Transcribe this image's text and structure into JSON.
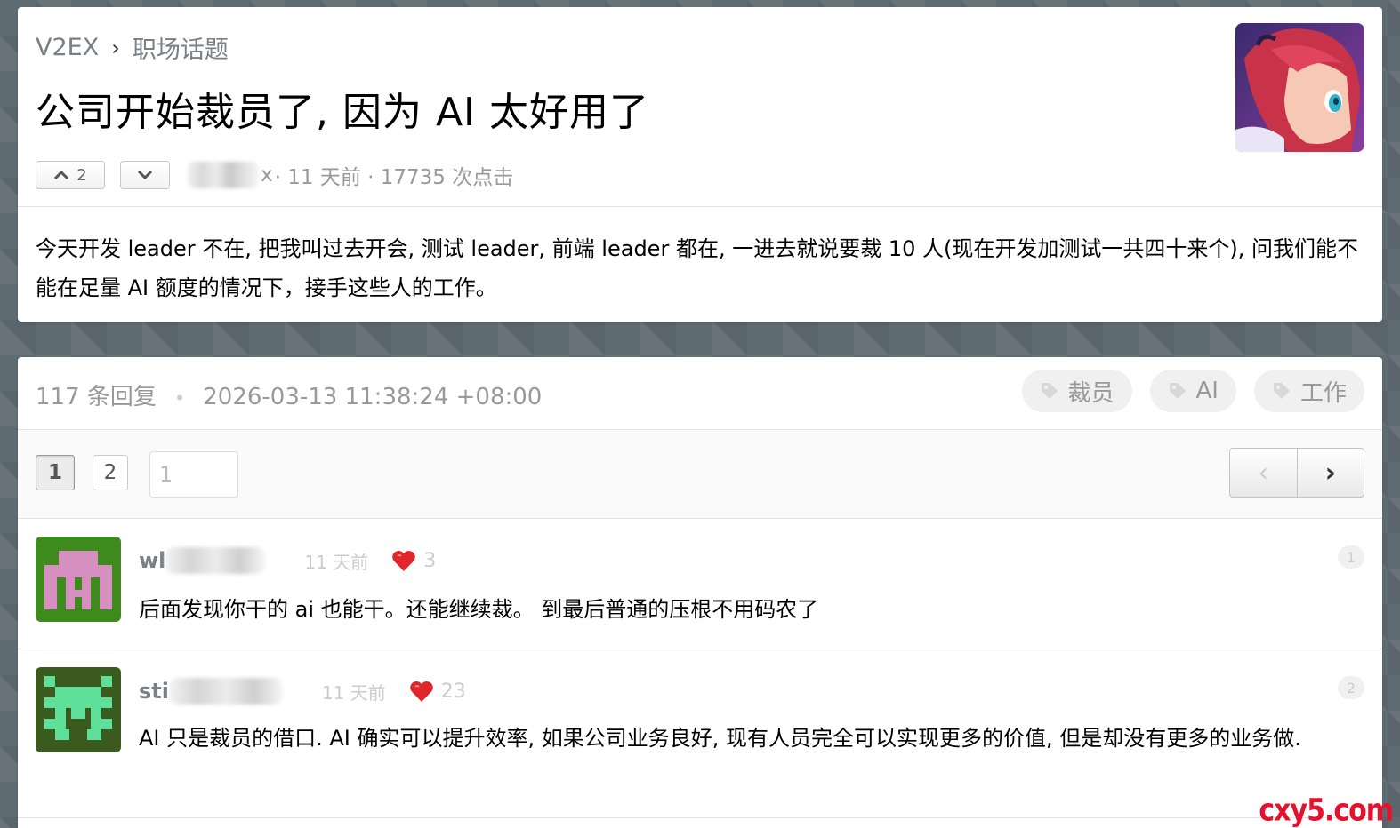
{
  "breadcrumb": {
    "site": "V2EX",
    "separator": "›",
    "node": "职场话题"
  },
  "topic": {
    "title": "公司开始裁员了, 因为 AI 太好用了",
    "upvote_count": "2",
    "author_suffix": "x",
    "meta": " · 11 天前 · 17735 次点击",
    "content": "今天开发 leader 不在, 把我叫过去开会, 测试 leader, 前端 leader 都在, 一进去就说要裁 10 人(现在开发加测试一共四十来个), 问我们能不能在足量 AI 额度的情况下，接手这些人的工作。"
  },
  "replies_header": {
    "count": "117 条回复",
    "dot": "•",
    "timestamp": "2026-03-13 11:38:24 +08:00",
    "tags": [
      "裁员",
      "AI",
      "工作"
    ]
  },
  "pagination": {
    "pages": [
      "1",
      "2"
    ],
    "current": "1",
    "input_value": "1",
    "prev": "‹",
    "next": "›"
  },
  "replies": [
    {
      "user_prefix": "wl",
      "time": "11 天前",
      "likes": "3",
      "number": "1",
      "text": "后面发现你干的 ai 也能干。还能继续裁。 到最后普通的压根不用码农了"
    },
    {
      "user_prefix": "sti",
      "time": "11 天前",
      "likes": "23",
      "number": "2",
      "text": "AI 只是裁员的借口. AI 确实可以提升效率, 如果公司业务良好, 现有人员完全可以实现更多的价值, 但是却没有更多的业务做."
    }
  ],
  "watermark": "cxy5.com",
  "colors": {
    "accent_link": "#778087",
    "heart": "#e0262b",
    "watermark": "#e8112d"
  }
}
